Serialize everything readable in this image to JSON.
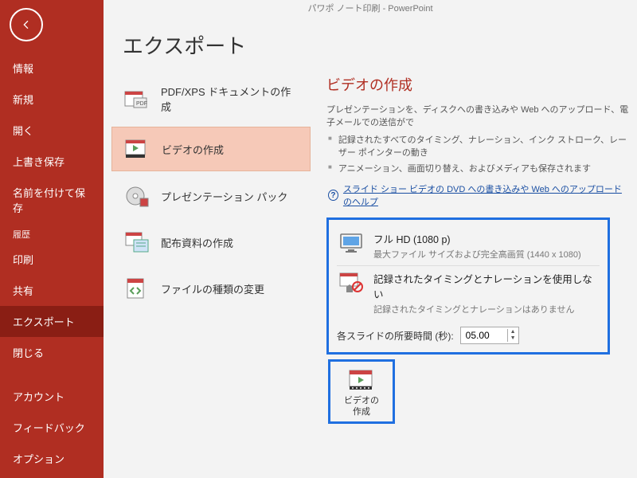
{
  "titlebar": "パワポ ノート印刷  -  PowerPoint",
  "page_title": "エクスポート",
  "sidebar": {
    "items": [
      "情報",
      "新規",
      "開く",
      "上書き保存",
      "名前を付けて保存",
      "印刷",
      "共有",
      "エクスポート",
      "閉じる"
    ],
    "history_label": "履歴",
    "footer": [
      "アカウント",
      "フィードバック",
      "オプション"
    ],
    "active_index": 7
  },
  "export_list": {
    "items": [
      {
        "label": "PDF/XPS ドキュメントの作成",
        "icon": "pdf"
      },
      {
        "label": "ビデオの作成",
        "icon": "video"
      },
      {
        "label": "プレゼンテーション パック",
        "icon": "cd"
      },
      {
        "label": "配布資料の作成",
        "icon": "handout"
      },
      {
        "label": "ファイルの種類の変更",
        "icon": "filetype"
      }
    ],
    "selected_index": 1
  },
  "detail": {
    "title": "ビデオの作成",
    "desc": "プレゼンテーションを、ディスクへの書き込みや Web へのアップロード、電子メールでの送信がで",
    "bullets": [
      "記録されたすべてのタイミング、ナレーション、インク ストローク、レーザー ポインターの動き",
      "アニメーション、画面切り替え、およびメディアも保存されます"
    ],
    "help_link": "スライド ショー ビデオの DVD への書き込みや Web へのアップロードのヘルプ",
    "quality": {
      "main": "フル HD (1080 p)",
      "sub": "最大ファイル サイズおよび完全高画質 (1440 x 1080)"
    },
    "timing": {
      "main": "記録されたタイミングとナレーションを使用しない",
      "sub": "記録されたタイミングとナレーションはありません"
    },
    "seconds_label": "各スライドの所要時間 (秒):",
    "seconds_value": "05.00",
    "create_label": "ビデオの\n作成"
  }
}
